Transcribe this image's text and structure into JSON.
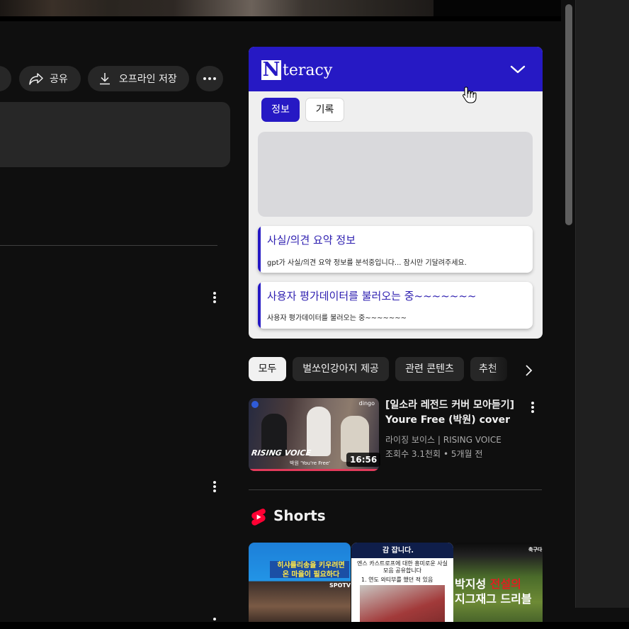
{
  "actions": {
    "share_label": "공유",
    "download_label": "오프라인 저장"
  },
  "nteracy": {
    "logo_mark": "N",
    "logo_text": "teracy",
    "tabs": [
      "정보",
      "기록"
    ],
    "cards": [
      {
        "title": "사실/의견 요약 정보",
        "text": "gpt가 사실/의견 요약 정보를 분석중입니다... 잠시만 기달려주세요."
      },
      {
        "title": "사용자 평가데이터를 불러오는 중~~~~~~~",
        "text": "사용자 평가데이터를 불러오는 중~~~~~~~"
      }
    ],
    "accent_color": "#2619c4"
  },
  "chips": [
    "모두",
    "벌쏘인강아지 제공",
    "관련 콘텐츠",
    "추천"
  ],
  "video": {
    "title": "[일소라 레전드 커버 모아듣기] Youre Free (박원) cover",
    "channel": "라이징 보이스 | RISING VOICE",
    "views": "조회수 3.1천회",
    "age": "5개월 전",
    "duration": "16:56",
    "thumb_brand": "dingo",
    "thumb_logo_text": "RISING VOICE",
    "thumb_caption": "박원 'You're Free'"
  },
  "shorts": {
    "title": "Shorts",
    "items": [
      {
        "text": "히샤를리송을 키우려면 온 마을이 필요하다",
        "badge": "SPOTV"
      },
      {
        "header": "감 잡니다.",
        "text": "엔스 카스트로프에 대한 흥미로운 사실 모음 공유합니다",
        "subtext": "1. 연도 와티부를 했던 적 있음"
      },
      {
        "label": "축구다",
        "text_plain_1": "박지성 ",
        "text_red": "전설의",
        "text_plain_2": "지그재그 드리블"
      }
    ]
  }
}
